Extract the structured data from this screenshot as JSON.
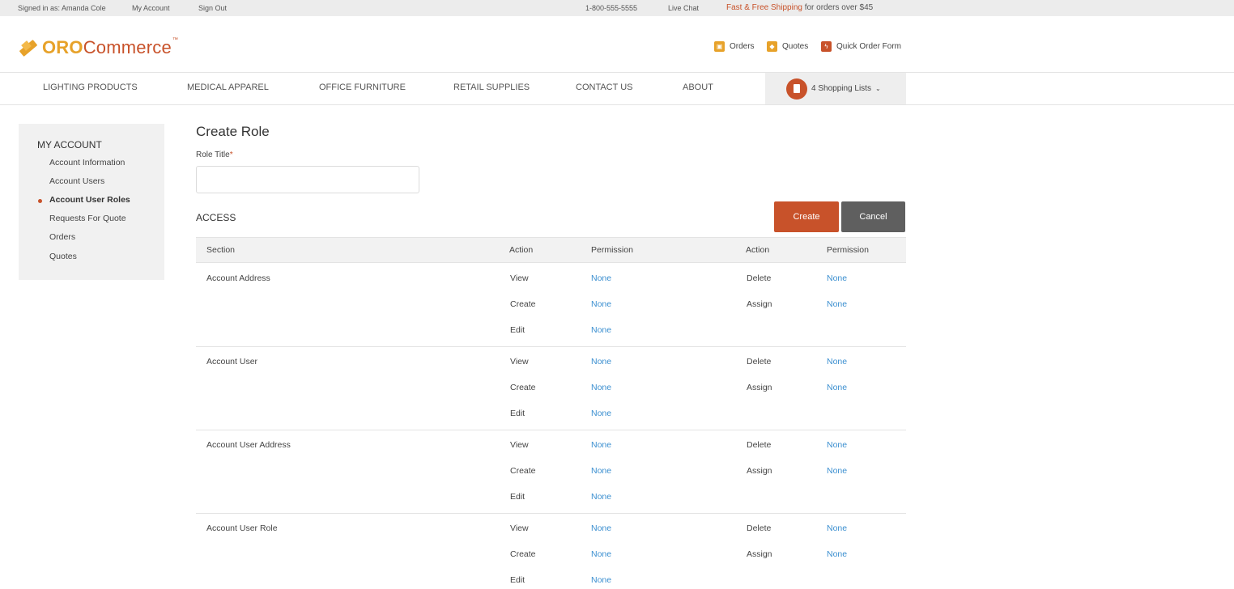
{
  "topbar": {
    "signed_in": "Signed in as: Amanda Cole",
    "my_account": "My Account",
    "sign_out": "Sign Out",
    "phone": "1-800-555-5555",
    "live_chat": "Live Chat",
    "shipping_highlight": "Fast & Free Shipping",
    "shipping_rest": " for orders over $45"
  },
  "brand": {
    "oro": "ORO",
    "commerce": "Commerce",
    "tm": "™"
  },
  "header_links": {
    "orders": "Orders",
    "quotes": "Quotes",
    "quick_order": "Quick Order Form"
  },
  "nav": {
    "items": [
      "LIGHTING PRODUCTS",
      "MEDICAL APPAREL",
      "OFFICE FURNITURE",
      "RETAIL SUPPLIES",
      "CONTACT US",
      "ABOUT"
    ],
    "shopping_lists": "4 Shopping Lists"
  },
  "sidebar": {
    "title": "MY ACCOUNT",
    "items": [
      "Account Information",
      "Account Users",
      "Account User Roles",
      "Requests For Quote",
      "Orders",
      "Quotes"
    ],
    "active_index": 2
  },
  "page": {
    "title": "Create Role",
    "role_title_label": "Role Title",
    "required_mark": "*",
    "role_title_value": "",
    "access_title": "ACCESS",
    "create_label": "Create",
    "cancel_label": "Cancel"
  },
  "table": {
    "headers": [
      "Section",
      "Action",
      "Permission",
      "Action",
      "Permission"
    ],
    "sections": [
      {
        "name": "Account Address",
        "left": [
          {
            "action": "View",
            "perm": "None"
          },
          {
            "action": "Create",
            "perm": "None"
          },
          {
            "action": "Edit",
            "perm": "None"
          }
        ],
        "right": [
          {
            "action": "Delete",
            "perm": "None"
          },
          {
            "action": "Assign",
            "perm": "None"
          }
        ]
      },
      {
        "name": "Account User",
        "left": [
          {
            "action": "View",
            "perm": "None"
          },
          {
            "action": "Create",
            "perm": "None"
          },
          {
            "action": "Edit",
            "perm": "None"
          }
        ],
        "right": [
          {
            "action": "Delete",
            "perm": "None"
          },
          {
            "action": "Assign",
            "perm": "None"
          }
        ]
      },
      {
        "name": "Account User Address",
        "left": [
          {
            "action": "View",
            "perm": "None"
          },
          {
            "action": "Create",
            "perm": "None"
          },
          {
            "action": "Edit",
            "perm": "None"
          }
        ],
        "right": [
          {
            "action": "Delete",
            "perm": "None"
          },
          {
            "action": "Assign",
            "perm": "None"
          }
        ]
      },
      {
        "name": "Account User Role",
        "left": [
          {
            "action": "View",
            "perm": "None"
          },
          {
            "action": "Create",
            "perm": "None"
          },
          {
            "action": "Edit",
            "perm": "None"
          }
        ],
        "right": [
          {
            "action": "Delete",
            "perm": "None"
          },
          {
            "action": "Assign",
            "perm": "None"
          }
        ]
      }
    ]
  },
  "colors": {
    "accent": "#c8522a",
    "brand_yellow": "#e7a22a",
    "link": "#3b8fd0",
    "cancel": "#5f5f5f"
  }
}
